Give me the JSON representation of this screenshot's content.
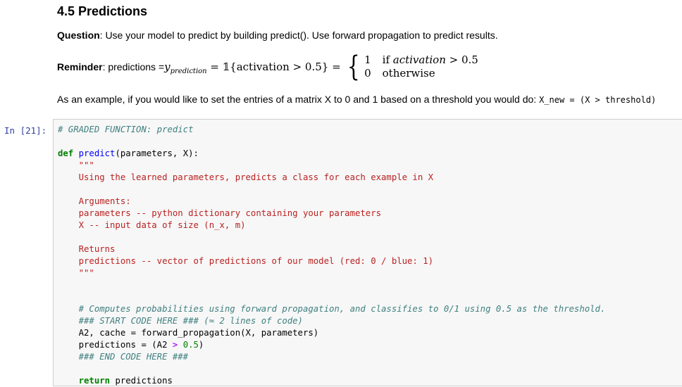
{
  "heading": "4.5 Predictions",
  "question": {
    "label": "Question",
    "text": ": Use your model to predict by building predict(). Use forward propagation to predict results."
  },
  "reminder": {
    "label": "Reminder",
    "prefix": ": predictions = ",
    "y": "y",
    "y_sub": "prediction",
    "eq1": " = 𝟙{activation > 0.5} =",
    "case1_val": "1",
    "case1_cond_if": "if ",
    "case1_cond_var": "activation",
    "case1_cond_rest": " > 0.5",
    "case2_val": "0",
    "case2_cond": "otherwise"
  },
  "example": {
    "text": "As an example, if you would like to set the entries of a matrix X to 0 and 1 based on a threshold you would do: ",
    "code": "X_new = (X > threshold)"
  },
  "cell": {
    "prompt": "In  [21]:",
    "lines": {
      "l1": "# GRADED FUNCTION: predict",
      "l3_kw": "def",
      "l3_fn": "predict",
      "l3_rest": "(parameters, X):",
      "l4": "    \"\"\"",
      "l5": "    Using the learned parameters, predicts a class for each example in X",
      "l7": "    Arguments:",
      "l8": "    parameters -- python dictionary containing your parameters",
      "l9": "    X -- input data of size (n_x, m)",
      "l11": "    Returns",
      "l12": "    predictions -- vector of predictions of our model (red: 0 / blue: 1)",
      "l13": "    \"\"\"",
      "l16": "    # Computes probabilities using forward propagation, and classifies to 0/1 using 0.5 as the threshold.",
      "l17": "    ### START CODE HERE ### (≈ 2 lines of code)",
      "l18": "    A2, cache = forward_propagation(X, parameters)",
      "l19_a": "    predictions = ",
      "l19_b": "(A2 ",
      "l19_op": ">",
      "l19_c": " ",
      "l19_num": "0.5",
      "l19_d": ")",
      "l20": "    ### END CODE HERE ###",
      "l22_kw": "return",
      "l22_rest": " predictions"
    }
  }
}
